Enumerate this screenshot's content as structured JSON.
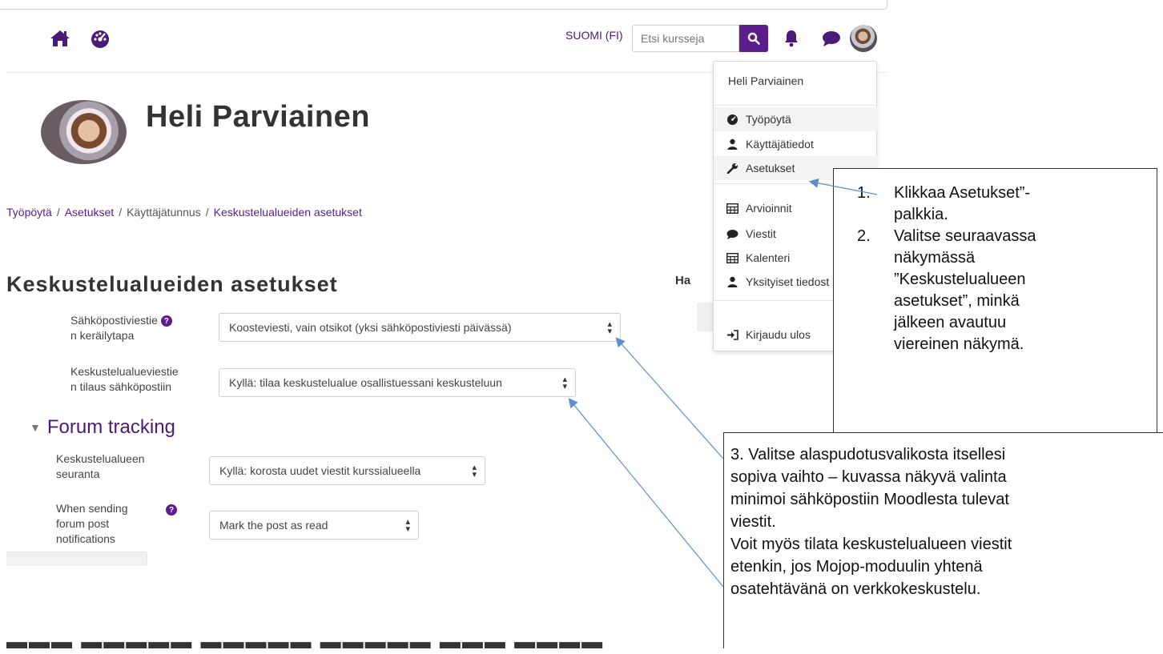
{
  "nav": {
    "home_icon": "home-icon",
    "dashboard_icon": "tachometer-icon",
    "language": "SUOMI (FI)",
    "search_placeholder": "Etsi kursseja",
    "search_icon": "search-icon",
    "notification_icon": "bell-icon",
    "message_icon": "chat-bubble-icon",
    "accent": "#5b1c8c"
  },
  "profile": {
    "name": "Heli Parviainen"
  },
  "breadcrumb": [
    "Työpöytä",
    "Asetukset",
    "Käyttäjätunnus",
    "Keskustelualueiden asetukset"
  ],
  "page_heading": "Keskustelualueiden asetukset",
  "settings": [
    {
      "label_line1": "Sähköpostiviestie",
      "label_line2": "n keräilytapa",
      "value": "Koosteviesti, vain otsikot (yksi sähköpostiviesti päivässä)"
    },
    {
      "label_line1": "Keskustelualueviestie",
      "label_line2": "n tilaus sähköpostiin",
      "value": "Kyllä: tilaa keskustelualue osallistuessani keskusteluun"
    }
  ],
  "forum_tracking": {
    "heading": "Forum tracking",
    "fields": [
      {
        "label_line1": "Keskustelualueen",
        "label_line2": "seuranta",
        "value": "Kyllä: korosta uudet viestit kurssialueella"
      },
      {
        "label_line1": "When sending",
        "label_line2": "forum post",
        "label_line3": "notifications",
        "value": "Mark the post as read"
      }
    ]
  },
  "side_partial_heading": "Ha",
  "user_menu": {
    "header": "Heli Parviainen",
    "items": [
      {
        "label": "Työpöytä",
        "icon": "tachometer-icon"
      },
      {
        "label": "Käyttäjätiedot",
        "icon": "user-icon"
      },
      {
        "label": "Asetukset",
        "icon": "wrench-icon"
      },
      {
        "label": "Arvioinnit",
        "icon": "table-icon"
      },
      {
        "label": "Viestit",
        "icon": "chat-bubble-icon"
      },
      {
        "label": "Kalenteri",
        "icon": "table-icon"
      },
      {
        "label": "Yksityiset tiedost",
        "icon": "user-icon"
      },
      {
        "label": "Kirjaudu ulos",
        "icon": "sign-out-icon"
      }
    ]
  },
  "callout_steps": {
    "steps": [
      {
        "num": "1.",
        "lines": [
          "Klikkaa Asetukset”-",
          "palkkia."
        ]
      },
      {
        "num": "2.",
        "lines": [
          "Valitse seuraavassa",
          "näkymässä",
          "”Keskustelualueen",
          "asetukset”, minkä",
          "jälkeen avautuu",
          "viereinen näkymä."
        ]
      }
    ]
  },
  "callout_dropdown": {
    "lines": [
      "3.  Valitse alaspudotusvalikosta itsellesi",
      "sopiva vaihto – kuvassa näkyvä valinta",
      "minimoi sähköpostiin Moodlesta tulevat",
      "viestit.",
      "Voit myös tilata keskustelualueen viestit",
      "etenkin, jos Mojop-moduulin yhtenä",
      "osatehtävänä on verkkokeskustelu."
    ]
  }
}
